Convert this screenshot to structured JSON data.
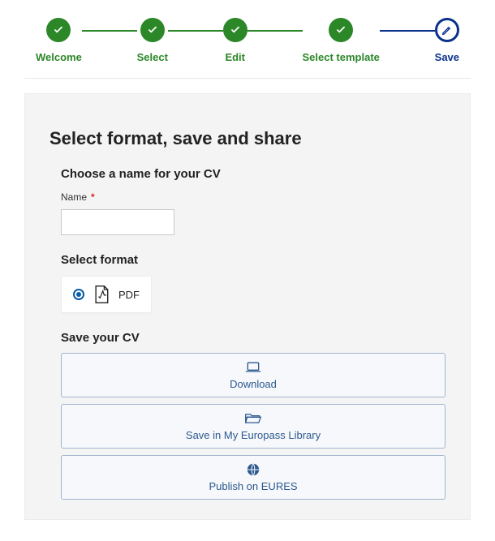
{
  "stepper": {
    "steps": [
      {
        "label": "Welcome",
        "state": "done"
      },
      {
        "label": "Select",
        "state": "done"
      },
      {
        "label": "Edit",
        "state": "done"
      },
      {
        "label": "Select template",
        "state": "done"
      },
      {
        "label": "Save",
        "state": "current"
      }
    ]
  },
  "panel": {
    "title": "Select format, save and share",
    "name_section": {
      "heading": "Choose a name for your CV",
      "field_label": "Name",
      "required_mark": "*",
      "value": ""
    },
    "format_section": {
      "heading": "Select format",
      "option_label": "PDF"
    },
    "save_section": {
      "heading": "Save your CV",
      "actions": [
        {
          "label": "Download"
        },
        {
          "label": "Save in My Europass Library"
        },
        {
          "label": "Publish on EURES"
        }
      ]
    }
  }
}
